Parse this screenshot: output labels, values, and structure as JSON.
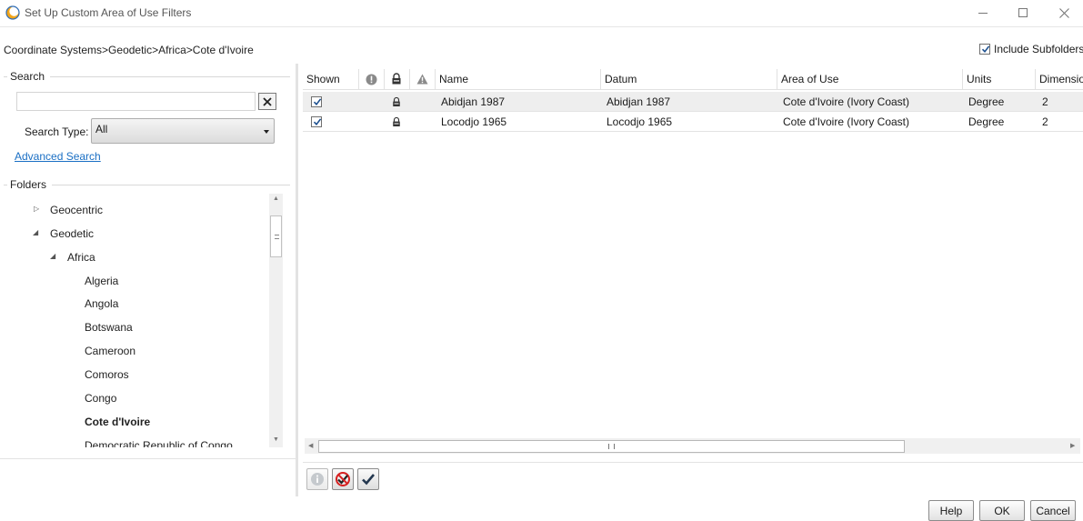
{
  "window": {
    "title": "Set Up Custom Area of Use Filters",
    "minimize_icon": "minimize-icon",
    "maximize_icon": "maximize-icon",
    "close_icon": "close-icon"
  },
  "breadcrumb": "Coordinate Systems>Geodetic>Africa>Cote d'Ivoire",
  "include_subfolders": {
    "label": "Include Subfolders",
    "checked": true
  },
  "search": {
    "group_label": "Search",
    "value": "",
    "search_type_label": "Search Type:",
    "search_type_value": "All",
    "advanced_link": "Advanced Search"
  },
  "folders": {
    "group_label": "Folders",
    "items": [
      {
        "label": "Geocentric",
        "level": 1,
        "toggle": "collapsed"
      },
      {
        "label": "Geodetic",
        "level": 1,
        "toggle": "expanded"
      },
      {
        "label": "Africa",
        "level": 2,
        "toggle": "expanded"
      },
      {
        "label": "Algeria",
        "level": 3
      },
      {
        "label": "Angola",
        "level": 3
      },
      {
        "label": "Botswana",
        "level": 3
      },
      {
        "label": "Cameroon",
        "level": 3
      },
      {
        "label": "Comoros",
        "level": 3
      },
      {
        "label": "Congo",
        "level": 3
      },
      {
        "label": "Cote d'Ivoire",
        "level": 3,
        "selected": true
      },
      {
        "label": "Democratic Republic of Congo",
        "level": 3
      }
    ]
  },
  "grid": {
    "columns": [
      "Shown",
      "",
      "",
      "",
      "Name",
      "Datum",
      "Area of Use",
      "Units",
      "Dimensio"
    ],
    "header_icons": [
      "info-icon",
      "lock-icon",
      "warning-icon"
    ],
    "rows": [
      {
        "shown": true,
        "name": "Abidjan 1987",
        "datum": "Abidjan 1987",
        "area": "Cote d'Ivoire (Ivory Coast)",
        "units": "Degree",
        "dimension": "2"
      },
      {
        "shown": true,
        "name": "Locodjo 1965",
        "datum": "Locodjo 1965",
        "area": "Cote d'Ivoire (Ivory Coast)",
        "units": "Degree",
        "dimension": "2"
      }
    ]
  },
  "toolbar": {
    "icons": [
      "info-icon",
      "uncheck-all-icon",
      "check-all-icon"
    ]
  },
  "buttons": {
    "help": "Help",
    "ok": "OK",
    "cancel": "Cancel"
  },
  "colors": {
    "link": "#1a6fc4",
    "selected_row": "#eeeeee"
  }
}
